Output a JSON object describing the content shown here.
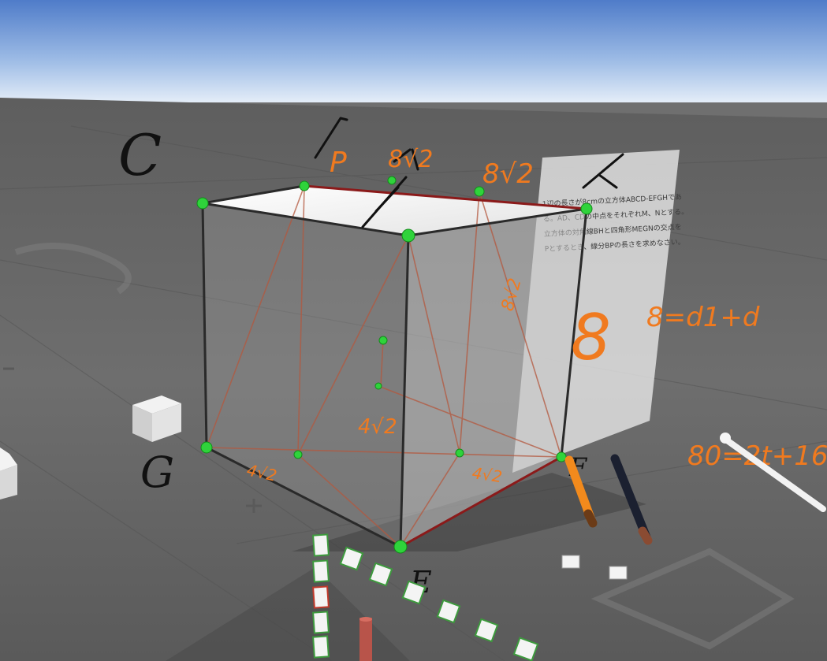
{
  "problem_panel": {
    "lines": [
      "1辺の長さが8cmの立方体ABCD-EFGHであ",
      "る。AD、CDの中点をそれぞれM、Nとする。",
      "立方体の対角線BHと四角形MEGNの交点を",
      "Pとするとき、線分BPの長さを求めなさい。"
    ]
  },
  "handwriting": {
    "vertex_C": "C",
    "vertex_G": "G",
    "vertex_E_bottom": "E",
    "vertex_F": "F",
    "top_label_1": "P",
    "top_label_2": "8√2",
    "top_label_3": "8√2",
    "side_label_8": "8",
    "eq_right": "8=d1+d",
    "eq_far_right": "80=2t+16",
    "face_label_4root2": "4√2",
    "bottom_left_label": "4√2",
    "bottom_right_label": "4√2",
    "right_face_label": "8√2"
  },
  "colors": {
    "sky_top": "#5b86d0",
    "sky_bottom": "#cfe0f5",
    "ground": "#6f6f6f",
    "ink_orange": "#f07a1f",
    "ink_black": "#111111",
    "vertex_green": "#2fd33b",
    "edge_red": "#8b1a1a"
  },
  "tools": {
    "pen_orange": "orange-pen",
    "pen_black": "black-pen",
    "pen_white": "white-pen",
    "pen_red": "red-pen"
  }
}
